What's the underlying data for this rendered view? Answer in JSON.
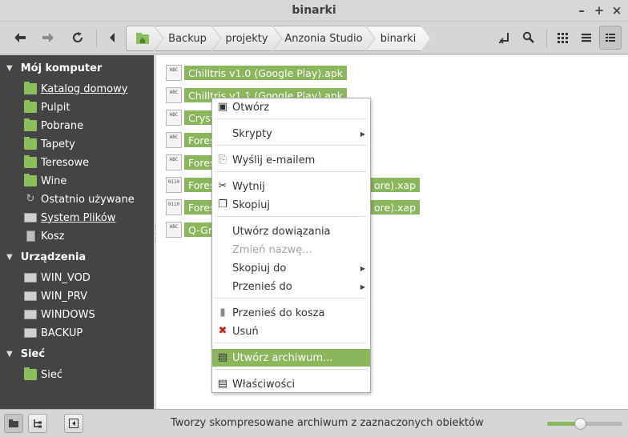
{
  "window": {
    "title": "binarki",
    "minimize_glyph": "–",
    "maximize_glyph": "+",
    "close_glyph": "×"
  },
  "toolbar": {
    "icons": [
      "back-icon",
      "forward-icon",
      "reload-icon",
      "toggle-location-icon",
      "search-icon",
      "icon-view-icon",
      "list-view-icon",
      "compact-view-icon"
    ],
    "breadcrumbs": [
      {
        "label": ""
      },
      {
        "label": "Backup"
      },
      {
        "label": "projekty"
      },
      {
        "label": "Anzonia Studio"
      },
      {
        "label": "binarki"
      }
    ]
  },
  "sidebar": {
    "sections": [
      {
        "title": "Mój komputer",
        "items": [
          {
            "label": "Katalog domowy",
            "icon": "home-folder-icon"
          },
          {
            "label": "Pulpit",
            "icon": "desktop-folder-icon"
          },
          {
            "label": "Pobrane",
            "icon": "downloads-folder-icon"
          },
          {
            "label": "Tapety",
            "icon": "folder-icon"
          },
          {
            "label": "Teresowe",
            "icon": "folder-icon"
          },
          {
            "label": "Wine",
            "icon": "folder-icon"
          },
          {
            "label": "Ostatnio używane",
            "icon": "recent-icon"
          },
          {
            "label": "System Plików",
            "icon": "drive-icon"
          },
          {
            "label": "Kosz",
            "icon": "trash-icon"
          }
        ]
      },
      {
        "title": "Urządzenia",
        "items": [
          {
            "label": "WIN_VOD",
            "icon": "drive-icon"
          },
          {
            "label": "WIN_PRV",
            "icon": "drive-icon"
          },
          {
            "label": "WINDOWS",
            "icon": "drive-icon"
          },
          {
            "label": "BACKUP",
            "icon": "drive-icon"
          }
        ]
      },
      {
        "title": "Sieć",
        "items": [
          {
            "label": "Sieć",
            "icon": "network-icon"
          }
        ]
      }
    ]
  },
  "files": [
    {
      "name": "Chilltris v1.0 (Google Play).apk",
      "icon": "text-file-icon",
      "icon_text": "ABC"
    },
    {
      "name": "Chilltris v1.1 (Google Play).apk",
      "icon": "text-file-icon",
      "icon_text": "ABC"
    },
    {
      "name": "Crysta",
      "icon": "text-file-icon",
      "icon_text": "ABC"
    },
    {
      "name": "Forest",
      "icon": "text-file-icon",
      "icon_text": "ABC"
    },
    {
      "name": "Forest",
      "icon": "text-file-icon",
      "icon_text": "ABC"
    },
    {
      "name": "Forest",
      "name_tail": "ore).xap",
      "icon": "binary-file-icon",
      "icon_text": "0110"
    },
    {
      "name": "Forest",
      "name_tail": "ore).xap",
      "icon": "binary-file-icon",
      "icon_text": "0110"
    },
    {
      "name": "Q-Gra",
      "icon": "text-file-icon",
      "icon_text": "ABC"
    }
  ],
  "context_menu": {
    "items": [
      {
        "label": "Otwórz",
        "icon": "open-icon"
      },
      {
        "label": "Skrypty",
        "submenu": true
      },
      {
        "label": "Wyślij e-mailem",
        "icon": "email-icon"
      },
      {
        "label": "Wytnij",
        "icon": "cut-icon"
      },
      {
        "label": "Skopiuj",
        "icon": "copy-icon"
      },
      {
        "label": "Utwórz dowiązania"
      },
      {
        "label": "Zmień nazwę...",
        "disabled": true
      },
      {
        "label": "Skopiuj do",
        "submenu": true
      },
      {
        "label": "Przenieś do",
        "submenu": true
      },
      {
        "label": "Przenieś do kosza",
        "icon": "trash-icon"
      },
      {
        "label": "Usuń",
        "icon": "delete-icon"
      },
      {
        "label": "Utwórz archiwum...",
        "icon": "archive-icon",
        "highlighted": true
      },
      {
        "label": "Właściwości",
        "icon": "properties-icon"
      }
    ]
  },
  "statusbar": {
    "text": "Tworzy skompresowane archiwum z zaznaczonych obiektów",
    "zoom_fraction": 0.45
  },
  "colors": {
    "accent": "#8ab65c",
    "sidebar_bg": "#444444"
  }
}
